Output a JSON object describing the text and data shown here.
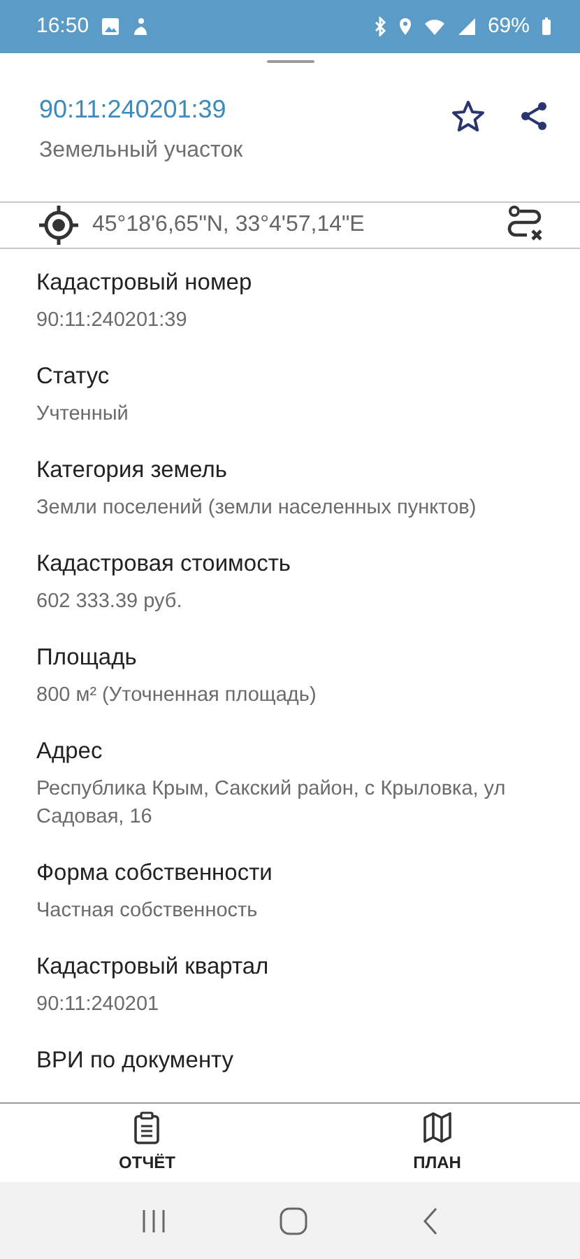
{
  "status_bar": {
    "time": "16:50",
    "battery": "69%"
  },
  "header": {
    "title": "90:11:240201:39",
    "subtitle": "Земельный участок",
    "favorite": false
  },
  "coordinates": "45°18'6,65\"N, 33°4'57,14\"E",
  "fields": [
    {
      "label": "Кадастровый номер",
      "value": "90:11:240201:39"
    },
    {
      "label": "Статус",
      "value": "Учтенный"
    },
    {
      "label": "Категория земель",
      "value": "Земли поселений (земли населенных пунктов)"
    },
    {
      "label": "Кадастровая стоимость",
      "value": "602 333.39 руб."
    },
    {
      "label": "Площадь",
      "value": "800 м² (Уточненная площадь)"
    },
    {
      "label": "Адрес",
      "value": "Республика Крым,  Сакский район, с Крыловка, ул Садовая,  16"
    },
    {
      "label": "Форма собственности",
      "value": "Частная собственность"
    },
    {
      "label": "Кадастровый квартал",
      "value": "90:11:240201"
    },
    {
      "label": "ВРИ по документу"
    }
  ],
  "bottom_nav": [
    {
      "kind": "report",
      "label": "ОТЧЁТ"
    },
    {
      "kind": "map",
      "label": "ПЛАН"
    }
  ]
}
